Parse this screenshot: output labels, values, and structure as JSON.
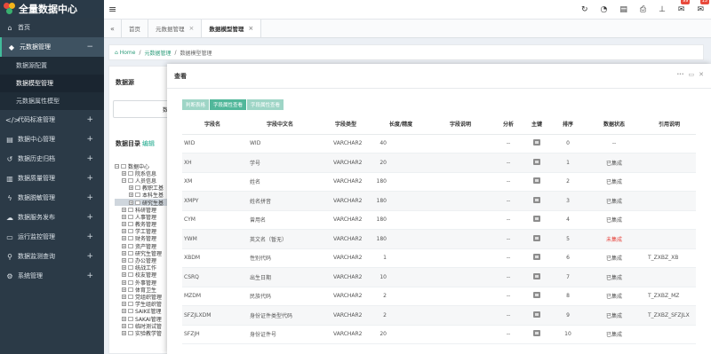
{
  "app": {
    "title": "全量数据中心"
  },
  "sidebar": {
    "items": [
      {
        "label": "首页",
        "icon": "home-icon",
        "glyph": "⌂"
      },
      {
        "label": "元数据管理",
        "icon": "tag-icon",
        "glyph": "◆",
        "expanded_symbol": "−"
      },
      {
        "label": "代码标准管理",
        "icon": "code-icon",
        "glyph": "</>"
      },
      {
        "label": "数据中心管理",
        "icon": "database-icon",
        "glyph": "▤"
      },
      {
        "label": "数据历史归档",
        "icon": "history-icon",
        "glyph": "↺"
      },
      {
        "label": "数据质量管理",
        "icon": "book-icon",
        "glyph": "▥"
      },
      {
        "label": "数据脱敏管理",
        "icon": "bolt-icon",
        "glyph": "ϟ"
      },
      {
        "label": "数据服务发布",
        "icon": "cloud-icon",
        "glyph": "☁"
      },
      {
        "label": "运行监控管理",
        "icon": "monitor-icon",
        "glyph": "▭"
      },
      {
        "label": "数据监测查询",
        "icon": "search-icon",
        "glyph": "⚲"
      },
      {
        "label": "系统管理",
        "icon": "gear-icon",
        "glyph": "⚙"
      }
    ],
    "sub_items": [
      {
        "label": "数据源配置"
      },
      {
        "label": "数据模型管理"
      },
      {
        "label": "元数据属性模型"
      }
    ],
    "plus": "+"
  },
  "topbar": {
    "menu_glyph": "≡",
    "icons": [
      {
        "name": "refresh-icon",
        "glyph": "↻"
      },
      {
        "name": "dashboard-icon",
        "glyph": "◔"
      },
      {
        "name": "server-icon",
        "glyph": "▤"
      },
      {
        "name": "print-icon",
        "glyph": "⎙"
      },
      {
        "name": "sitemap-icon",
        "glyph": "⊥"
      },
      {
        "name": "message-icon",
        "glyph": "✉",
        "badge": "99"
      },
      {
        "name": "bell-icon",
        "glyph": "✉",
        "badge": "15"
      }
    ]
  },
  "tabs": {
    "prev_glyph": "«",
    "items": [
      {
        "label": "首页",
        "closable": false
      },
      {
        "label": "元数据管理",
        "closable": true
      },
      {
        "label": "数据模型管理",
        "closable": true
      }
    ],
    "close_glyph": "×"
  },
  "breadcrumb": {
    "home": "Home",
    "level1": "元数据管理",
    "current": "数据模型管理",
    "sep": "/"
  },
  "left_panel": {
    "source_title": "数据源",
    "source_value": "数",
    "tree_title": "数据目录",
    "tree_edit": "编辑",
    "tree": [
      {
        "label": "数据中心",
        "indent": 0,
        "box": "−"
      },
      {
        "label": "院系信息",
        "indent": 1,
        "box": "+"
      },
      {
        "label": "人员信息",
        "indent": 1,
        "box": "−"
      },
      {
        "label": "教职工基",
        "indent": 2,
        "box": "+"
      },
      {
        "label": "本科生基",
        "indent": 2,
        "box": "+"
      },
      {
        "label": "研究生基",
        "indent": 2,
        "box": "+",
        "highlight": true
      },
      {
        "label": "科研管理",
        "indent": 1,
        "box": "+"
      },
      {
        "label": "人事管理",
        "indent": 1,
        "box": "+"
      },
      {
        "label": "教务管理",
        "indent": 1,
        "box": "+"
      },
      {
        "label": "学工管理",
        "indent": 1,
        "box": "+"
      },
      {
        "label": "财务管理",
        "indent": 1,
        "box": "+"
      },
      {
        "label": "资产管理",
        "indent": 1,
        "box": "+"
      },
      {
        "label": "研究生管理",
        "indent": 1,
        "box": "+"
      },
      {
        "label": "办公管理",
        "indent": 1,
        "box": "+"
      },
      {
        "label": "统战工作",
        "indent": 1,
        "box": "+"
      },
      {
        "label": "校友管理",
        "indent": 1,
        "box": "+"
      },
      {
        "label": "外事管理",
        "indent": 1,
        "box": "+"
      },
      {
        "label": "体育卫生",
        "indent": 1,
        "box": "+"
      },
      {
        "label": "党组织管理",
        "indent": 1,
        "box": "+"
      },
      {
        "label": "学生组织管",
        "indent": 1,
        "box": "+"
      },
      {
        "label": "SAIKE管理",
        "indent": 1,
        "box": "+"
      },
      {
        "label": "SAKAI管理",
        "indent": 1,
        "box": "+"
      },
      {
        "label": "临时测试管",
        "indent": 1,
        "box": "+"
      },
      {
        "label": "实验教学管",
        "indent": 1,
        "box": "+"
      }
    ]
  },
  "modal": {
    "title": "查看",
    "controls": [
      "···",
      "▭",
      "✕"
    ],
    "buttons": [
      {
        "label": "判断表格",
        "active": false
      },
      {
        "label": "字段属性查看",
        "active": true
      },
      {
        "label": "字段属性查看",
        "active": false
      }
    ],
    "columns": [
      "字段名",
      "字段中文名",
      "字段类型",
      "长度/精度",
      "字段说明",
      "分析",
      "主键",
      "排序",
      "数据状态",
      "引用说明"
    ],
    "rows": [
      {
        "name": "WID",
        "cn": "WID",
        "type": "VARCHAR2",
        "len": "40",
        "desc": "",
        "analysis": "--",
        "pk": true,
        "order": "0",
        "status": "--",
        "status_bad": false,
        "ref": ""
      },
      {
        "name": "XH",
        "cn": "学号",
        "type": "VARCHAR2",
        "len": "20",
        "desc": "",
        "analysis": "--",
        "pk": true,
        "order": "1",
        "status": "已集成",
        "status_bad": false,
        "ref": ""
      },
      {
        "name": "XM",
        "cn": "姓名",
        "type": "VARCHAR2",
        "len": "180",
        "desc": "",
        "analysis": "--",
        "pk": true,
        "order": "2",
        "status": "已集成",
        "status_bad": false,
        "ref": ""
      },
      {
        "name": "XMPY",
        "cn": "姓名拼音",
        "type": "VARCHAR2",
        "len": "180",
        "desc": "",
        "analysis": "--",
        "pk": true,
        "order": "3",
        "status": "已集成",
        "status_bad": false,
        "ref": ""
      },
      {
        "name": "CYM",
        "cn": "曾用名",
        "type": "VARCHAR2",
        "len": "180",
        "desc": "",
        "analysis": "--",
        "pk": true,
        "order": "4",
        "status": "已集成",
        "status_bad": false,
        "ref": ""
      },
      {
        "name": "YWM",
        "cn": "英文名（暂无）",
        "type": "VARCHAR2",
        "len": "180",
        "desc": "",
        "analysis": "--",
        "pk": true,
        "order": "5",
        "status": "未集成",
        "status_bad": true,
        "ref": ""
      },
      {
        "name": "XBDM",
        "cn": "性别代码",
        "type": "VARCHAR2",
        "len": "1",
        "desc": "",
        "analysis": "--",
        "pk": true,
        "order": "6",
        "status": "已集成",
        "status_bad": false,
        "ref": "T_ZXBZ_XB"
      },
      {
        "name": "CSRQ",
        "cn": "出生日期",
        "type": "VARCHAR2",
        "len": "10",
        "desc": "",
        "analysis": "--",
        "pk": true,
        "order": "7",
        "status": "已集成",
        "status_bad": false,
        "ref": ""
      },
      {
        "name": "MZDM",
        "cn": "民族代码",
        "type": "VARCHAR2",
        "len": "2",
        "desc": "",
        "analysis": "--",
        "pk": true,
        "order": "8",
        "status": "已集成",
        "status_bad": false,
        "ref": "T_ZXBZ_MZ"
      },
      {
        "name": "SFZJLXDM",
        "cn": "身份证件类型代码",
        "type": "VARCHAR2",
        "len": "2",
        "desc": "",
        "analysis": "--",
        "pk": true,
        "order": "9",
        "status": "已集成",
        "status_bad": false,
        "ref": "T_ZXBZ_SFZJLX"
      },
      {
        "name": "SFZJH",
        "cn": "身份证件号",
        "type": "VARCHAR2",
        "len": "20",
        "desc": "",
        "analysis": "--",
        "pk": true,
        "order": "10",
        "status": "已集成",
        "status_bad": false,
        "ref": ""
      }
    ]
  },
  "colors": {
    "accent": "#51b79a",
    "sidebar_bg": "#2b3a47",
    "danger": "#e6413a"
  }
}
